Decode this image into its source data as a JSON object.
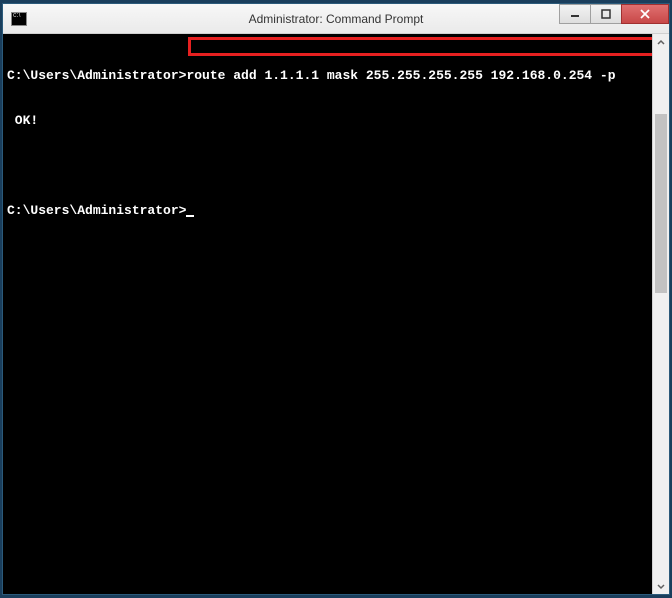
{
  "window": {
    "title": "Administrator: Command Prompt",
    "icon_name": "cmd-icon"
  },
  "terminal": {
    "lines": [
      {
        "prompt": "C:\\Users\\Administrator>",
        "command": "route add 1.1.1.1 mask 255.255.255.255 192.168.0.254 -p"
      },
      {
        "text": " OK!"
      },
      {
        "text": ""
      },
      {
        "prompt": "C:\\Users\\Administrator>",
        "cursor": true
      }
    ]
  },
  "highlight": {
    "description": "red-box-around-route-add-command"
  }
}
